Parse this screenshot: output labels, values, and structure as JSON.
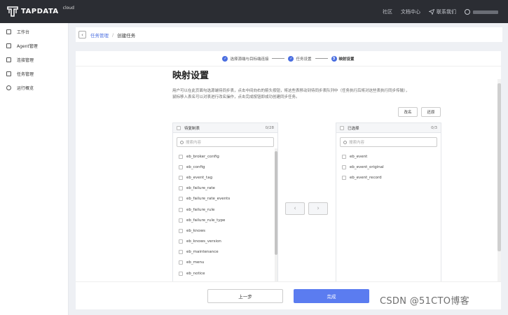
{
  "header": {
    "logo_text": "TAPDATA",
    "logo_sup": "cloud",
    "nav": [
      "社区",
      "文档中心",
      "联系我们"
    ]
  },
  "sidebar": {
    "items": [
      {
        "label": "工作台",
        "icon": "dashboard-icon"
      },
      {
        "label": "Agent管理",
        "icon": "agent-icon"
      },
      {
        "label": "连接管理",
        "icon": "connection-icon"
      },
      {
        "label": "任务管理",
        "icon": "task-icon"
      },
      {
        "label": "运行概览",
        "icon": "overview-icon"
      }
    ]
  },
  "breadcrumb": {
    "parent": "任务管理",
    "current": "创建任务"
  },
  "steps": [
    {
      "label": "选择源端与目标端连接",
      "state": "done"
    },
    {
      "label": "任务设置",
      "state": "done"
    },
    {
      "label": "映射设置",
      "state": "active",
      "num": "3"
    }
  ],
  "main": {
    "title": "映射设置",
    "description": "用户可以在此页面勾选源端待同步表，点击中间向右的箭头按钮，将这些表移动到待同步表队列中（任务执行后将对这些表执行同步传输），鼠标移入表名可以对表进行改名操作，点击完成按钮即成功创建同步任务。",
    "rename_btn": "改名",
    "restore_btn": "还原"
  },
  "source_panel": {
    "title": "待复制表",
    "count": "0/28",
    "search_placeholder": "搜索内容",
    "items": [
      "eb_broker_config",
      "eb_config",
      "eb_event_tag",
      "eb_failure_rate",
      "eb_failure_rate_events",
      "eb_failure_rule",
      "eb_failure_rule_type",
      "eb_knows",
      "eb_knows_version",
      "eb_maintenance",
      "eb_menu",
      "eb_notice"
    ]
  },
  "target_panel": {
    "title": "已选择",
    "count": "0/3",
    "search_placeholder": "搜索内容",
    "items": [
      "eb_event",
      "eb_event_original",
      "eb_event_record"
    ]
  },
  "footer": {
    "prev_btn": "上一步",
    "done_btn": "完成"
  },
  "watermark": "CSDN @51CTO博客",
  "colors": {
    "accent": "#5b7cf0",
    "topbar": "#2b2d33"
  }
}
